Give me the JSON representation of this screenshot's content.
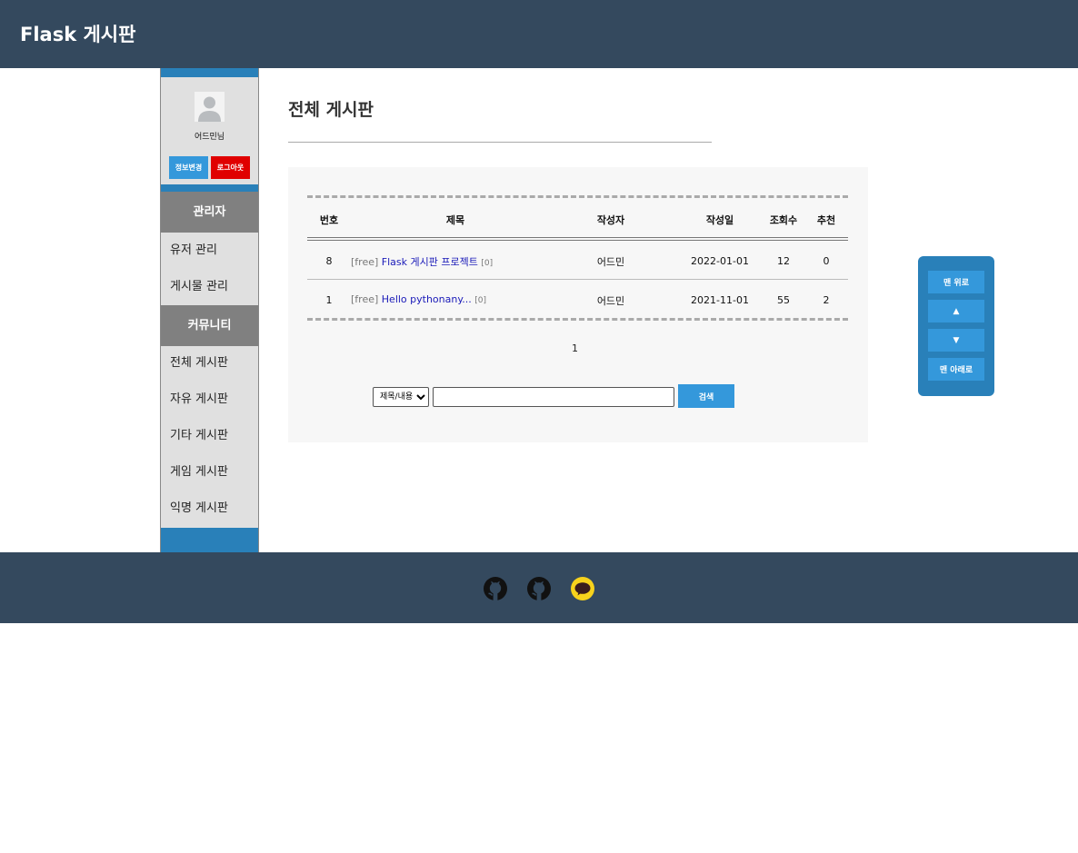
{
  "header": {
    "brand": "Flask 게시판"
  },
  "sidebar": {
    "username": "어드민님",
    "edit_label": "정보변경",
    "logout_label": "로그아웃",
    "admin_header": "관리자",
    "admin_items": [
      {
        "label": "유저 관리"
      },
      {
        "label": "게시물 관리"
      }
    ],
    "community_header": "커뮤니티",
    "community_items": [
      {
        "label": "전체 게시판"
      },
      {
        "label": "자유 게시판"
      },
      {
        "label": "기타 게시판"
      },
      {
        "label": "게임 게시판"
      },
      {
        "label": "익명 게시판"
      }
    ]
  },
  "main": {
    "title": "전체 게시판"
  },
  "table": {
    "columns": [
      "번호",
      "제목",
      "작성자",
      "작성일",
      "조회수",
      "추천"
    ],
    "rows": [
      {
        "no": "8",
        "category": "[free]",
        "title": "Flask 게시판 프로젝트",
        "comments": "[0]",
        "author": "어드민",
        "date": "2022-01-01",
        "views": "12",
        "recommend": "0"
      },
      {
        "no": "1",
        "category": "[free]",
        "title": "Hello pythonany...",
        "comments": "[0]",
        "author": "어드민",
        "date": "2021-11-01",
        "views": "55",
        "recommend": "2"
      }
    ]
  },
  "pagination": {
    "current": "1"
  },
  "search": {
    "select_value": "제목/내용",
    "input_value": "",
    "button_label": "검색"
  },
  "scroll_panel": {
    "top_label": "맨 위로",
    "up_label": "▲",
    "down_label": "▼",
    "bottom_label": "맨 아래로"
  },
  "footer": {
    "icons": [
      "github-icon",
      "github-icon",
      "kakaotalk-icon"
    ]
  },
  "colors": {
    "header_bg": "#34495e",
    "sidebar_band": "#2980b9",
    "button_blue": "#3498db",
    "logout_red": "#e00000",
    "link": "#1a1ab8"
  }
}
